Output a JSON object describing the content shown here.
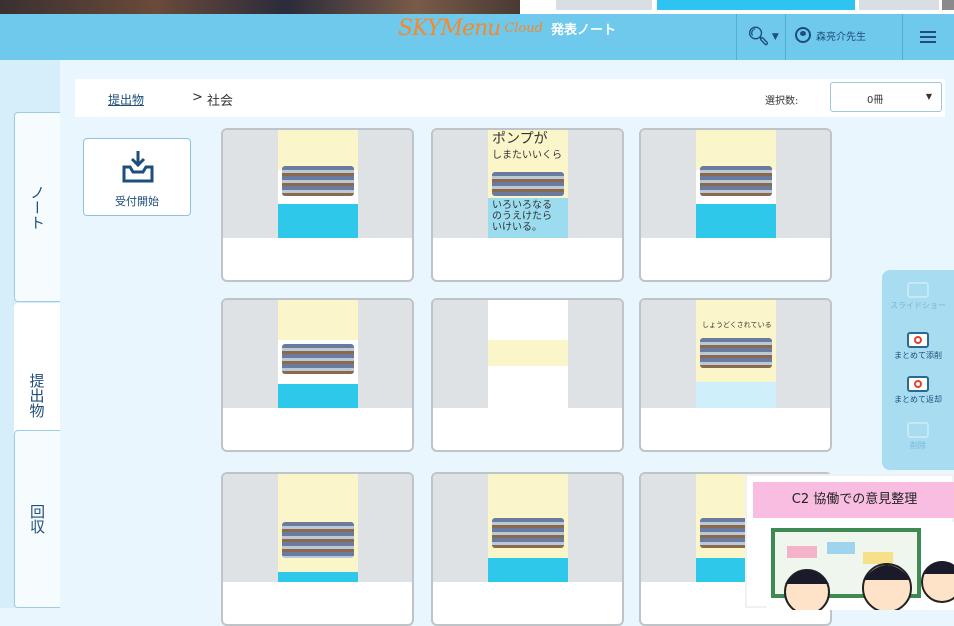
{
  "header": {
    "brand": "SKYMenu",
    "brand_sub": "Cloud",
    "app_title": "発表ノート",
    "user_name": "森亮介先生",
    "search_icon": "search-icon",
    "menu_icon": "hamburger-menu-icon"
  },
  "sidebar": {
    "tabs": [
      {
        "label": "ノート"
      },
      {
        "label": "提出物",
        "active": true
      },
      {
        "label": "回収"
      }
    ]
  },
  "breadcrumb": {
    "home": "提出物",
    "separator": ">",
    "current": "社会"
  },
  "selection": {
    "label": "選択数:",
    "value": "0冊",
    "caret": "▼"
  },
  "receive_button": {
    "label": "受付開始",
    "icon": "inbox-tray-icon"
  },
  "cards": [
    {
      "type": "bus-diagram"
    },
    {
      "type": "handwritten",
      "text_top": "ポンプが\nしまたいいくら",
      "text_bottom": "いろいろなる\nのうえけたら\nいけいる。"
    },
    {
      "type": "bus-diagram"
    },
    {
      "type": "bus-diagram-caption"
    },
    {
      "type": "text-slip"
    },
    {
      "type": "bus-caption",
      "text_top": "しょうどくされている"
    },
    {
      "type": "bus-title"
    },
    {
      "type": "bus-boxes"
    },
    {
      "type": "bus-boxes"
    }
  ],
  "right_panel": {
    "items": [
      {
        "label": "スライドショー",
        "enabled": false
      },
      {
        "label": "まとめて添削",
        "enabled": true
      },
      {
        "label": "まとめて返却",
        "enabled": true
      },
      {
        "label": "削除",
        "enabled": false
      }
    ]
  },
  "callout": {
    "title": "C2 協働での意見整理"
  },
  "colors": {
    "header_bg": "#6ec9ec",
    "body_bg": "#eaf6fd",
    "brand_orange": "#f48a2b",
    "nav_text": "#1e4e7a",
    "callout_pink": "#f9bde1"
  }
}
